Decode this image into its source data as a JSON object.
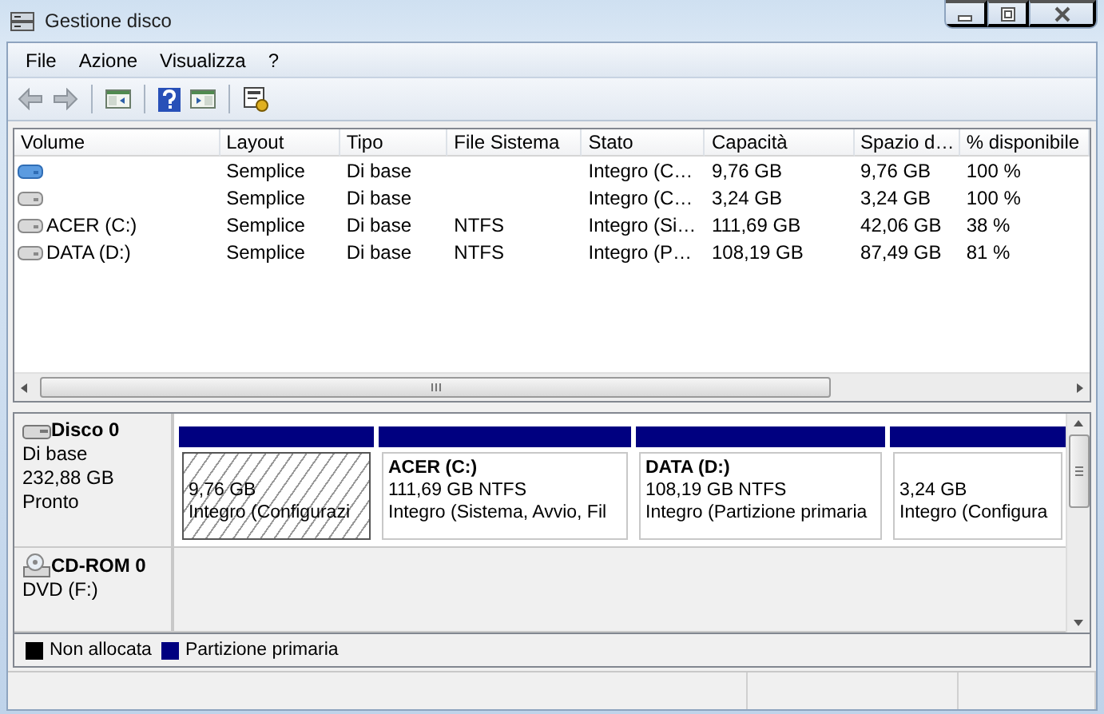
{
  "window": {
    "title": "Gestione disco"
  },
  "menu": [
    "File",
    "Azione",
    "Visualizza",
    "?"
  ],
  "volume_table": {
    "columns": [
      "Volume",
      "Layout",
      "Tipo",
      "File Sistema",
      "Stato",
      "Capacità",
      "Spazio d…",
      "% disponibile"
    ],
    "rows": [
      {
        "kind": "blue",
        "cells": [
          "",
          "Semplice",
          "Di base",
          "",
          "Integro (C…",
          "9,76 GB",
          "9,76 GB",
          "100 %"
        ]
      },
      {
        "kind": "grey",
        "cells": [
          "",
          "Semplice",
          "Di base",
          "",
          "Integro (C…",
          "3,24 GB",
          "3,24 GB",
          "100 %"
        ]
      },
      {
        "kind": "grey",
        "cells": [
          "ACER (C:)",
          "Semplice",
          "Di base",
          "NTFS",
          "Integro (Si…",
          "111,69 GB",
          "42,06 GB",
          "38 %"
        ]
      },
      {
        "kind": "grey",
        "cells": [
          "DATA (D:)",
          "Semplice",
          "Di base",
          "NTFS",
          "Integro (P…",
          "108,19 GB",
          "87,49 GB",
          "81 %"
        ]
      }
    ]
  },
  "disks": [
    {
      "kind": "disk",
      "name": "Disco 0",
      "details": [
        "Di base",
        "232,88 GB",
        "Pronto"
      ],
      "partitions": [
        {
          "selected": true,
          "size": "9,76 GB",
          "status": "Integro (Configurazi"
        },
        {
          "selected": false,
          "name": "ACER  (C:)",
          "size": "111,69 GB NTFS",
          "status": "Integro (Sistema, Avvio, Fil"
        },
        {
          "selected": false,
          "name": "DATA  (D:)",
          "size": "108,19 GB NTFS",
          "status": "Integro (Partizione primaria"
        },
        {
          "selected": false,
          "size": "3,24 GB",
          "status": "Integro (Configura"
        }
      ]
    },
    {
      "kind": "cdrom",
      "name": "CD-ROM 0",
      "details": [
        "DVD (F:)"
      ]
    }
  ],
  "legend": [
    {
      "label": "Non allocata",
      "color": "#000000"
    },
    {
      "label": "Partizione primaria",
      "color": "#000080"
    }
  ]
}
